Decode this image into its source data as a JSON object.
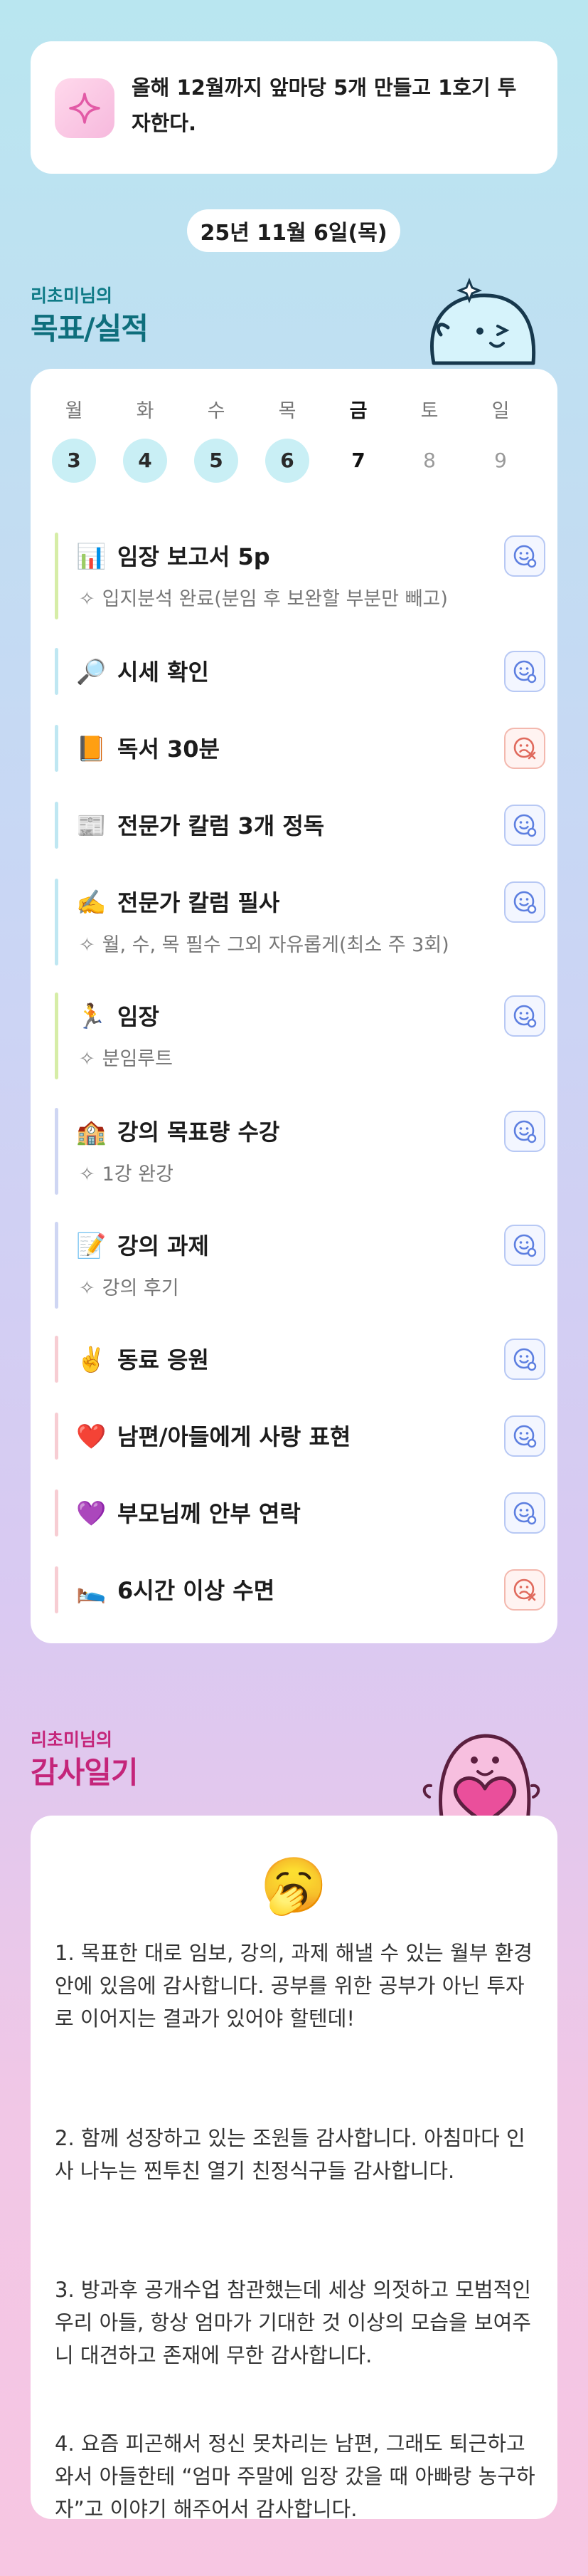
{
  "goal": {
    "text": "올해 12월까지 앞마당 5개 만들고 1호기 투자한다.",
    "icon": "sparkle-icon"
  },
  "date": "25년 11월 6일(목)",
  "goals_section": {
    "subtitle": "리초미님의",
    "title": "목표/실적"
  },
  "week": [
    {
      "wd": "월",
      "dn": "3",
      "state": "done"
    },
    {
      "wd": "화",
      "dn": "4",
      "state": "done"
    },
    {
      "wd": "수",
      "dn": "5",
      "state": "done"
    },
    {
      "wd": "목",
      "dn": "6",
      "state": "done"
    },
    {
      "wd": "금",
      "dn": "7",
      "state": "today"
    },
    {
      "wd": "토",
      "dn": "8",
      "state": "future"
    },
    {
      "wd": "일",
      "dn": "9",
      "state": "future"
    }
  ],
  "tasks": [
    {
      "emoji": "📊",
      "name": "임장 보고서 5p",
      "note": "입지분석 완료(분임 후 보완할 부분만 빼고)",
      "status": "good",
      "bar": "#d6eda7"
    },
    {
      "emoji": "🔎",
      "name": "시세 확인",
      "note": "",
      "status": "good",
      "bar": "#bfe7f2"
    },
    {
      "emoji": "📙",
      "name": "독서 30분",
      "note": "",
      "status": "bad",
      "bar": "#bfe7f2"
    },
    {
      "emoji": "📰",
      "name": "전문가 칼럼 3개 정독",
      "note": "",
      "status": "good",
      "bar": "#bfe7f2"
    },
    {
      "emoji": "✍️",
      "name": "전문가 칼럼 필사",
      "note": "월, 수, 목 필수 그외 자유롭게(최소 주 3회)",
      "status": "good",
      "bar": "#bfe7f2"
    },
    {
      "emoji": "🏃",
      "name": "임장",
      "note": "분임루트",
      "status": "good",
      "bar": "#d6eda7"
    },
    {
      "emoji": "🏫",
      "name": "강의 목표량 수강",
      "note": "1강 완강",
      "status": "good",
      "bar": "#cfd6f3"
    },
    {
      "emoji": "📝",
      "name": "강의 과제",
      "note": "강의 후기",
      "status": "good",
      "bar": "#cfd6f3"
    },
    {
      "emoji": "✌️",
      "name": "동료 응원",
      "note": "",
      "status": "good",
      "bar": "#f7cdd3"
    },
    {
      "emoji": "❤️",
      "name": "남편/아들에게 사랑 표현",
      "note": "",
      "status": "good",
      "bar": "#f7cdd3"
    },
    {
      "emoji": "💜",
      "name": "부모님께 안부 연락",
      "note": "",
      "status": "good",
      "bar": "#f7cdd3"
    },
    {
      "emoji": "🛌",
      "name": "6시간 이상 수면",
      "note": "",
      "status": "bad",
      "bar": "#f7cdd3"
    }
  ],
  "gratitude_section": {
    "subtitle": "리초미님의",
    "title": "감사일기"
  },
  "gratitude": {
    "emoji": "🥱",
    "paragraphs": [
      "1. 목표한 대로 임보, 강의, 과제 해낼 수 있는 월부 환경 안에 있음에 감사합니다. 공부를 위한 공부가 아닌 투자로 이어지는 결과가 있어야 할텐데!",
      "2. 함께 성장하고 있는 조원들 감사합니다. 아침마다 인사 나누는 찐투친 열기 친정식구들 감사합니다.",
      "3. 방과후 공개수업 참관했는데 세상 의젓하고 모범적인 우리 아들, 항상 엄마가 기대한 것 이상의 모습을 보여주니 대견하고 존재에 무한 감사합니다.",
      "4. 요즘 피곤해서 정신 못차리는 남편, 그래도 퇴근하고 와서 아들한테 “엄마 주말에 임장 갔을 때 아빠랑 농구하자”고 이야기 해주어서 감사합니다."
    ]
  },
  "colors": {
    "teal": "#0e6e7c",
    "pink": "#c4257a",
    "done_circle": "#c9eff5"
  }
}
